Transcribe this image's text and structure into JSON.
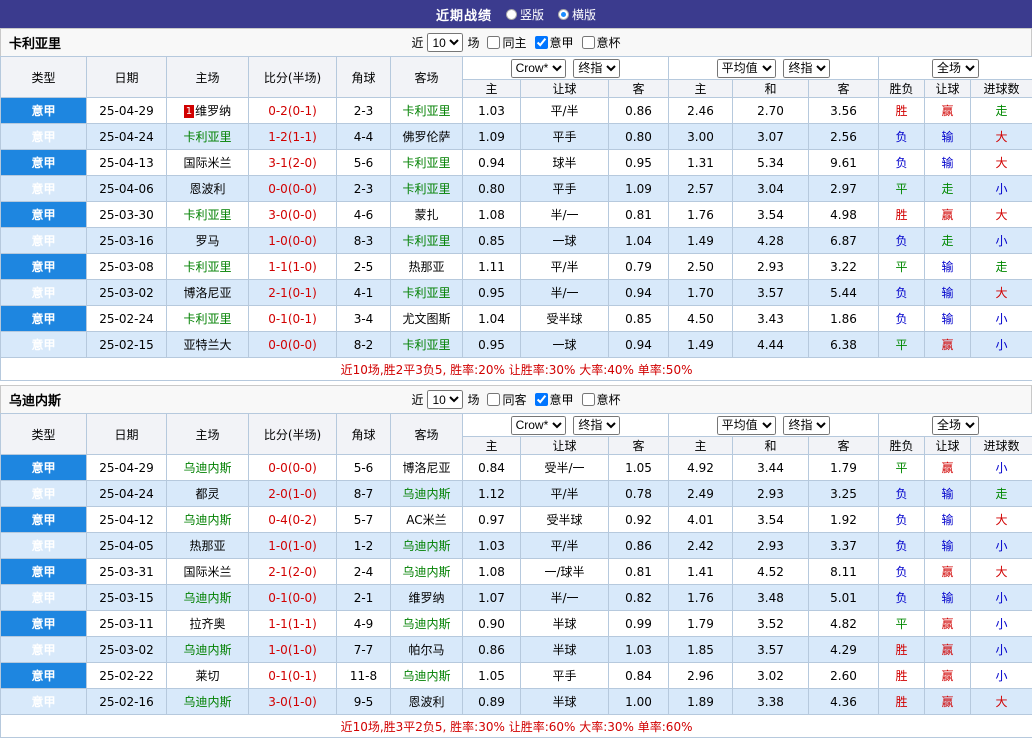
{
  "topbar": {
    "title": "近期战绩",
    "radios": [
      {
        "label": "竖版",
        "selected": false
      },
      {
        "label": "横版",
        "selected": true
      }
    ]
  },
  "labels": {
    "recent": "近",
    "games": "场",
    "type": "类型",
    "date": "日期",
    "home": "主场",
    "score": "比分(半场)",
    "corner": "角球",
    "away": "客场",
    "odds_home": "主",
    "odds_handicap": "让球",
    "odds_away": "客",
    "avg_home": "主",
    "avg_draw": "和",
    "avg_away": "客",
    "result": "胜负",
    "handicap_result": "让球",
    "goals": "进球数"
  },
  "dropdowns": {
    "bookmaker": "Crow*",
    "final": "终指",
    "average": "平均值",
    "full_match": "全场"
  },
  "colors": {
    "topbar_bg": "#3b3b8e",
    "league_cell_bg": "#1e86e0",
    "row_alt_bg": "#d8e9fa",
    "border": "#b6c9dd",
    "header_bg": "#f2f3f7",
    "focus_team": "#008000",
    "score": "#d10000",
    "summary": "#d10000",
    "value_colors": {
      "胜": "#d10000",
      "平": "#008800",
      "负": "#0000cc",
      "赢": "#d10000",
      "输": "#0000cc",
      "走": "#008800",
      "大": "#d10000",
      "小": "#0000cc"
    }
  },
  "sections": [
    {
      "team": "卡利亚里",
      "filter": {
        "count": "10",
        "checkboxes": [
          {
            "label": "同主",
            "checked": false
          },
          {
            "label": "意甲",
            "checked": true
          },
          {
            "label": "意杯",
            "checked": false
          }
        ]
      },
      "rows": [
        {
          "league": "意甲",
          "date": "25-04-29",
          "home": "维罗纳",
          "home_rank": "1",
          "home_focus": false,
          "score": "0-2(0-1)",
          "corner": "2-3",
          "away": "卡利亚里",
          "away_focus": true,
          "odds": [
            "1.03",
            "平/半",
            "0.86"
          ],
          "avg": [
            "2.46",
            "2.70",
            "3.56"
          ],
          "result": "胜",
          "handicap": "赢",
          "goals": "走"
        },
        {
          "league": "意甲",
          "date": "25-04-24",
          "home": "卡利亚里",
          "home_focus": true,
          "score": "1-2(1-1)",
          "corner": "4-4",
          "away": "佛罗伦萨",
          "away_focus": false,
          "odds": [
            "1.09",
            "平手",
            "0.80"
          ],
          "avg": [
            "3.00",
            "3.07",
            "2.56"
          ],
          "result": "负",
          "handicap": "输",
          "goals": "大"
        },
        {
          "league": "意甲",
          "date": "25-04-13",
          "home": "国际米兰",
          "home_focus": false,
          "score": "3-1(2-0)",
          "corner": "5-6",
          "away": "卡利亚里",
          "away_focus": true,
          "odds": [
            "0.94",
            "球半",
            "0.95"
          ],
          "avg": [
            "1.31",
            "5.34",
            "9.61"
          ],
          "result": "负",
          "handicap": "输",
          "goals": "大"
        },
        {
          "league": "意甲",
          "date": "25-04-06",
          "home": "恩波利",
          "home_focus": false,
          "score": "0-0(0-0)",
          "corner": "2-3",
          "away": "卡利亚里",
          "away_focus": true,
          "odds": [
            "0.80",
            "平手",
            "1.09"
          ],
          "avg": [
            "2.57",
            "3.04",
            "2.97"
          ],
          "result": "平",
          "handicap": "走",
          "goals": "小"
        },
        {
          "league": "意甲",
          "date": "25-03-30",
          "home": "卡利亚里",
          "home_focus": true,
          "score": "3-0(0-0)",
          "corner": "4-6",
          "away": "蒙扎",
          "away_focus": false,
          "odds": [
            "1.08",
            "半/一",
            "0.81"
          ],
          "avg": [
            "1.76",
            "3.54",
            "4.98"
          ],
          "result": "胜",
          "handicap": "赢",
          "goals": "大"
        },
        {
          "league": "意甲",
          "date": "25-03-16",
          "home": "罗马",
          "home_focus": false,
          "score": "1-0(0-0)",
          "corner": "8-3",
          "away": "卡利亚里",
          "away_focus": true,
          "odds": [
            "0.85",
            "一球",
            "1.04"
          ],
          "avg": [
            "1.49",
            "4.28",
            "6.87"
          ],
          "result": "负",
          "handicap": "走",
          "goals": "小"
        },
        {
          "league": "意甲",
          "date": "25-03-08",
          "home": "卡利亚里",
          "home_focus": true,
          "score": "1-1(1-0)",
          "corner": "2-5",
          "away": "热那亚",
          "away_focus": false,
          "odds": [
            "1.11",
            "平/半",
            "0.79"
          ],
          "avg": [
            "2.50",
            "2.93",
            "3.22"
          ],
          "result": "平",
          "handicap": "输",
          "goals": "走"
        },
        {
          "league": "意甲",
          "date": "25-03-02",
          "home": "博洛尼亚",
          "home_focus": false,
          "score": "2-1(0-1)",
          "corner": "4-1",
          "away": "卡利亚里",
          "away_focus": true,
          "odds": [
            "0.95",
            "半/一",
            "0.94"
          ],
          "avg": [
            "1.70",
            "3.57",
            "5.44"
          ],
          "result": "负",
          "handicap": "输",
          "goals": "大"
        },
        {
          "league": "意甲",
          "date": "25-02-24",
          "home": "卡利亚里",
          "home_focus": true,
          "score": "0-1(0-1)",
          "corner": "3-4",
          "away": "尤文图斯",
          "away_focus": false,
          "odds": [
            "1.04",
            "受半球",
            "0.85"
          ],
          "avg": [
            "4.50",
            "3.43",
            "1.86"
          ],
          "result": "负",
          "handicap": "输",
          "goals": "小"
        },
        {
          "league": "意甲",
          "date": "25-02-15",
          "home": "亚特兰大",
          "home_focus": false,
          "score": "0-0(0-0)",
          "corner": "8-2",
          "away": "卡利亚里",
          "away_focus": true,
          "odds": [
            "0.95",
            "一球",
            "0.94"
          ],
          "avg": [
            "1.49",
            "4.44",
            "6.38"
          ],
          "result": "平",
          "handicap": "赢",
          "goals": "小"
        }
      ],
      "summary": "近10场,胜2平3负5, 胜率:20% 让胜率:30% 大率:40% 单率:50%"
    },
    {
      "team": "乌迪内斯",
      "filter": {
        "count": "10",
        "checkboxes": [
          {
            "label": "同客",
            "checked": false
          },
          {
            "label": "意甲",
            "checked": true
          },
          {
            "label": "意杯",
            "checked": false
          }
        ]
      },
      "rows": [
        {
          "league": "意甲",
          "date": "25-04-29",
          "home": "乌迪内斯",
          "home_focus": true,
          "score": "0-0(0-0)",
          "corner": "5-6",
          "away": "博洛尼亚",
          "away_focus": false,
          "odds": [
            "0.84",
            "受半/一",
            "1.05"
          ],
          "avg": [
            "4.92",
            "3.44",
            "1.79"
          ],
          "result": "平",
          "handicap": "赢",
          "goals": "小"
        },
        {
          "league": "意甲",
          "date": "25-04-24",
          "home": "都灵",
          "home_focus": false,
          "score": "2-0(1-0)",
          "corner": "8-7",
          "away": "乌迪内斯",
          "away_focus": true,
          "odds": [
            "1.12",
            "平/半",
            "0.78"
          ],
          "avg": [
            "2.49",
            "2.93",
            "3.25"
          ],
          "result": "负",
          "handicap": "输",
          "goals": "走"
        },
        {
          "league": "意甲",
          "date": "25-04-12",
          "home": "乌迪内斯",
          "home_focus": true,
          "score": "0-4(0-2)",
          "corner": "5-7",
          "away": "AC米兰",
          "away_focus": false,
          "odds": [
            "0.97",
            "受半球",
            "0.92"
          ],
          "avg": [
            "4.01",
            "3.54",
            "1.92"
          ],
          "result": "负",
          "handicap": "输",
          "goals": "大"
        },
        {
          "league": "意甲",
          "date": "25-04-05",
          "home": "热那亚",
          "home_focus": false,
          "score": "1-0(1-0)",
          "corner": "1-2",
          "away": "乌迪内斯",
          "away_focus": true,
          "odds": [
            "1.03",
            "平/半",
            "0.86"
          ],
          "avg": [
            "2.42",
            "2.93",
            "3.37"
          ],
          "result": "负",
          "handicap": "输",
          "goals": "小"
        },
        {
          "league": "意甲",
          "date": "25-03-31",
          "home": "国际米兰",
          "home_focus": false,
          "score": "2-1(2-0)",
          "corner": "2-4",
          "away": "乌迪内斯",
          "away_focus": true,
          "odds": [
            "1.08",
            "一/球半",
            "0.81"
          ],
          "avg": [
            "1.41",
            "4.52",
            "8.11"
          ],
          "result": "负",
          "handicap": "赢",
          "goals": "大"
        },
        {
          "league": "意甲",
          "date": "25-03-15",
          "home": "乌迪内斯",
          "home_focus": true,
          "score": "0-1(0-0)",
          "corner": "2-1",
          "away": "维罗纳",
          "away_focus": false,
          "odds": [
            "1.07",
            "半/一",
            "0.82"
          ],
          "avg": [
            "1.76",
            "3.48",
            "5.01"
          ],
          "result": "负",
          "handicap": "输",
          "goals": "小"
        },
        {
          "league": "意甲",
          "date": "25-03-11",
          "home": "拉齐奥",
          "home_focus": false,
          "score": "1-1(1-1)",
          "corner": "4-9",
          "away": "乌迪内斯",
          "away_focus": true,
          "odds": [
            "0.90",
            "半球",
            "0.99"
          ],
          "avg": [
            "1.79",
            "3.52",
            "4.82"
          ],
          "result": "平",
          "handicap": "赢",
          "goals": "小"
        },
        {
          "league": "意甲",
          "date": "25-03-02",
          "home": "乌迪内斯",
          "home_focus": true,
          "score": "1-0(1-0)",
          "corner": "7-7",
          "away": "帕尔马",
          "away_focus": false,
          "odds": [
            "0.86",
            "半球",
            "1.03"
          ],
          "avg": [
            "1.85",
            "3.57",
            "4.29"
          ],
          "result": "胜",
          "handicap": "赢",
          "goals": "小"
        },
        {
          "league": "意甲",
          "date": "25-02-22",
          "home": "莱切",
          "home_focus": false,
          "score": "0-1(0-1)",
          "corner": "11-8",
          "away": "乌迪内斯",
          "away_focus": true,
          "odds": [
            "1.05",
            "平手",
            "0.84"
          ],
          "avg": [
            "2.96",
            "3.02",
            "2.60"
          ],
          "result": "胜",
          "handicap": "赢",
          "goals": "小"
        },
        {
          "league": "意甲",
          "date": "25-02-16",
          "home": "乌迪内斯",
          "home_focus": true,
          "score": "3-0(1-0)",
          "corner": "9-5",
          "away": "恩波利",
          "away_focus": false,
          "odds": [
            "0.89",
            "半球",
            "1.00"
          ],
          "avg": [
            "1.89",
            "3.38",
            "4.36"
          ],
          "result": "胜",
          "handicap": "赢",
          "goals": "大"
        }
      ],
      "summary": "近10场,胜3平2负5, 胜率:30% 让胜率:60% 大率:30% 单率:60%"
    }
  ]
}
